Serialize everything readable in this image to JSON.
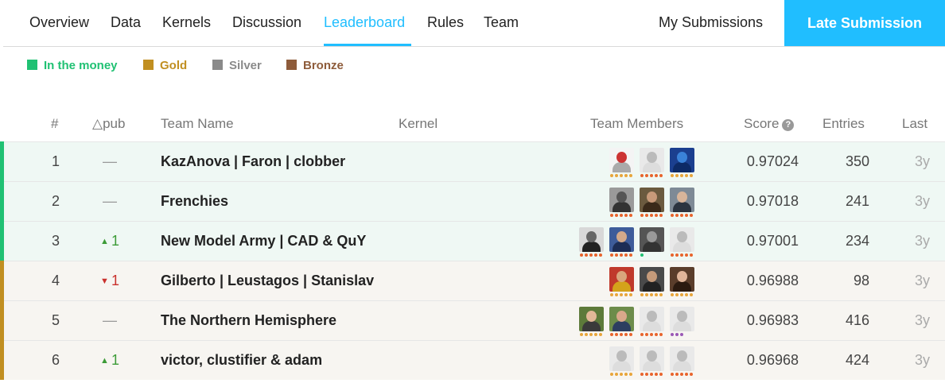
{
  "nav": {
    "tabs": [
      {
        "label": "Overview",
        "active": false
      },
      {
        "label": "Data",
        "active": false
      },
      {
        "label": "Kernels",
        "active": false
      },
      {
        "label": "Discussion",
        "active": false
      },
      {
        "label": "Leaderboard",
        "active": true
      },
      {
        "label": "Rules",
        "active": false
      },
      {
        "label": "Team",
        "active": false
      }
    ],
    "my_submissions": "My Submissions",
    "late_submission": "Late Submission"
  },
  "legend": [
    {
      "label": "In the money",
      "color": "#20c173",
      "text_color": "#20c173"
    },
    {
      "label": "Gold",
      "color": "#c18f21",
      "text_color": "#c18f21"
    },
    {
      "label": "Silver",
      "color": "#8a8a8a",
      "text_color": "#8a8a8a"
    },
    {
      "label": "Bronze",
      "color": "#8e5c3b",
      "text_color": "#8e5c3b"
    }
  ],
  "table": {
    "headers": {
      "rank": "#",
      "delta": "△pub",
      "team": "Team Name",
      "kernel": "Kernel",
      "members": "Team Members",
      "score": "Score",
      "entries": "Entries",
      "last": "Last"
    },
    "rows": [
      {
        "rank": "1",
        "delta": "—",
        "delta_dir": "none",
        "team": "KazAnova | Faron | clobber",
        "score": "0.97024",
        "entries": "350",
        "last": "3y",
        "band": "money",
        "row_bg": "#eff8f4",
        "members": [
          {
            "icon": "sketch-avatar",
            "bg": "#f4f4f4",
            "head": "#c33",
            "body": "#aaa",
            "tier": "#e8a53a"
          },
          {
            "icon": "goose-avatar",
            "bg": "#e9e9e9",
            "head": "#bbb",
            "body": "#ddd",
            "tier": "#e8642c"
          },
          {
            "icon": "matrix-avatar",
            "bg": "#1b3f8f",
            "head": "#3a82d8",
            "body": "#0d2a66",
            "tier": "#e8a53a"
          }
        ]
      },
      {
        "rank": "2",
        "delta": "—",
        "delta_dir": "none",
        "team": "Frenchies",
        "score": "0.97018",
        "entries": "241",
        "last": "3y",
        "band": "money",
        "row_bg": "#eff8f4",
        "members": [
          {
            "icon": "person-avatar",
            "bg": "#9a9a9a",
            "head": "#555",
            "body": "#333",
            "tier": "#e8642c"
          },
          {
            "icon": "person-avatar",
            "bg": "#6b5a3f",
            "head": "#c89a7a",
            "body": "#3a2a1a",
            "tier": "#e8642c"
          },
          {
            "icon": "person-avatar",
            "bg": "#7e8a96",
            "head": "#d8b59a",
            "body": "#2b3440",
            "tier": "#e8642c"
          }
        ]
      },
      {
        "rank": "3",
        "delta": "1",
        "delta_dir": "up",
        "team": "New Model Army | CAD & QuY",
        "score": "0.97001",
        "entries": "234",
        "last": "3y",
        "band": "money",
        "row_bg": "#eff8f4",
        "members": [
          {
            "icon": "person-avatar",
            "bg": "#d8d8d8",
            "head": "#666",
            "body": "#222",
            "tier": "#e8642c"
          },
          {
            "icon": "person-avatar",
            "bg": "#3e5c9a",
            "head": "#d3a98a",
            "body": "#1d2d55",
            "tier": "#e8642c"
          },
          {
            "icon": "person-avatar",
            "bg": "#555",
            "head": "#999",
            "body": "#333",
            "tier": "#20c173"
          },
          {
            "icon": "goose-avatar",
            "bg": "#e9e9e9",
            "head": "#bbb",
            "body": "#ddd",
            "tier": "#e8642c"
          }
        ]
      },
      {
        "rank": "4",
        "delta": "1",
        "delta_dir": "down",
        "team": "Gilberto | Leustagos | Stanislav",
        "score": "0.96988",
        "entries": "98",
        "last": "3y",
        "band": "gold",
        "row_bg": "#f7f5f1",
        "members": [
          {
            "icon": "person-avatar",
            "bg": "#c0392b",
            "head": "#d9a57c",
            "body": "#d4a21b",
            "tier": "#e8a53a"
          },
          {
            "icon": "person-avatar",
            "bg": "#4a4a4a",
            "head": "#c49a7a",
            "body": "#222",
            "tier": "#e8a53a"
          },
          {
            "icon": "person-avatar",
            "bg": "#5a3d2b",
            "head": "#e0b59a",
            "body": "#2b1a10",
            "tier": "#e8a53a"
          }
        ]
      },
      {
        "rank": "5",
        "delta": "—",
        "delta_dir": "none",
        "team": "The Northern Hemisphere",
        "score": "0.96983",
        "entries": "416",
        "last": "3y",
        "band": "gold",
        "row_bg": "#f7f5f1",
        "members": [
          {
            "icon": "person-avatar",
            "bg": "#5d7a3a",
            "head": "#e2b897",
            "body": "#3a3a3a",
            "tier": "#e8a53a"
          },
          {
            "icon": "person-avatar",
            "bg": "#6d8c4a",
            "head": "#d9a88a",
            "body": "#2c3e60",
            "tier": "#e8642c"
          },
          {
            "icon": "goose-avatar",
            "bg": "#e9e9e9",
            "head": "#bbb",
            "body": "#ddd",
            "tier": "#e8642c"
          },
          {
            "icon": "goose-avatar",
            "bg": "#e9e9e9",
            "head": "#bbb",
            "body": "#ddd",
            "tier": "#9b59b6"
          }
        ]
      },
      {
        "rank": "6",
        "delta": "1",
        "delta_dir": "up",
        "team": "victor, clustifier & adam",
        "score": "0.96968",
        "entries": "424",
        "last": "3y",
        "band": "gold",
        "row_bg": "#f7f5f1",
        "members": [
          {
            "icon": "goose-avatar",
            "bg": "#e9e9e9",
            "head": "#bbb",
            "body": "#ddd",
            "tier": "#e8a53a"
          },
          {
            "icon": "goose-avatar",
            "bg": "#e9e9e9",
            "head": "#bbb",
            "body": "#ddd",
            "tier": "#e8642c"
          },
          {
            "icon": "goose-avatar",
            "bg": "#e9e9e9",
            "head": "#bbb",
            "body": "#ddd",
            "tier": "#e8642c"
          }
        ]
      }
    ]
  },
  "colors": {
    "accent": "#20beff",
    "band_money": "#20c173",
    "band_gold": "#c18f21"
  }
}
